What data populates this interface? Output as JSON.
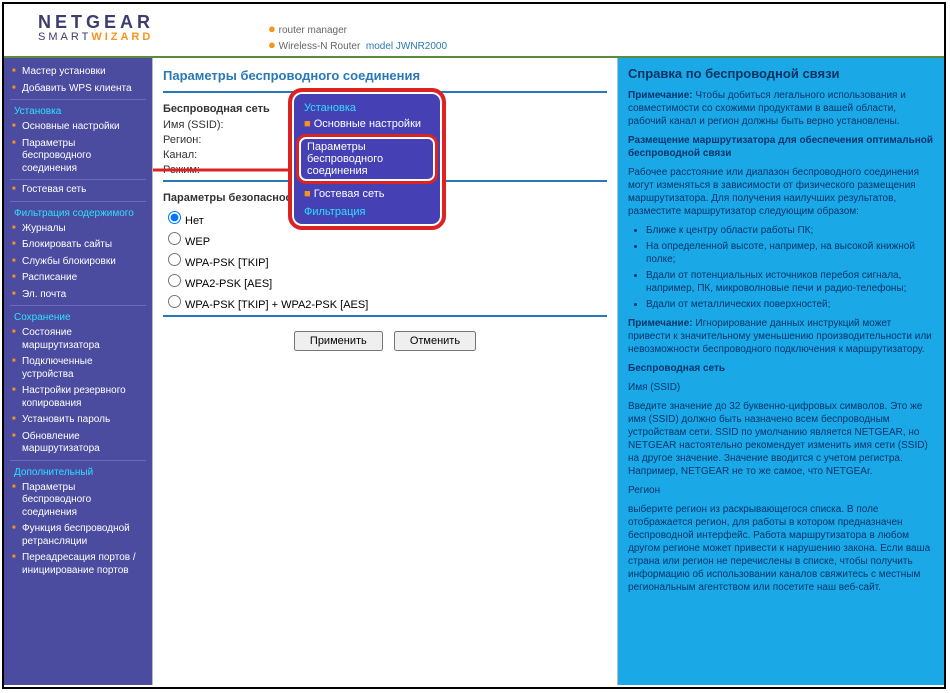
{
  "header": {
    "brand": "NETGEAR",
    "smart": "SMART",
    "wizard": "WIZARD",
    "router_manager": "router manager",
    "router_line": "Wireless-N Router",
    "model_label": "model",
    "model": "JWNR2000"
  },
  "sidebar": {
    "top": [
      "Мастер установки",
      "Добавить WPS клиента"
    ],
    "s1_head": "Установка",
    "s1": [
      "Основные настройки",
      "Параметры беспроводного соединения"
    ],
    "s2_items": [
      "Гостевая сеть"
    ],
    "s3_head": "Фильтрация содержимого",
    "s3": [
      "Журналы",
      "Блокировать сайты",
      "Службы блокировки",
      "Расписание",
      "Эл. почта"
    ],
    "s4_head": "Сохранение",
    "s4": [
      "Состояние маршрутизатора",
      "Подключенные устройства",
      "Настройки резервного копирования",
      "Установить пароль",
      "Обновление маршрутизатора"
    ],
    "s5_head": "Дополнительный",
    "s5": [
      "Параметры беспроводного соединения",
      "Функция беспроводной ретрансляции",
      "Переадресация портов / инициирование портов"
    ]
  },
  "main": {
    "title": "Параметры беспроводного соединения",
    "wireless_head": "Беспроводная сеть",
    "ssid_label": "Имя (SSID):",
    "region_label": "Регион:",
    "channel_label": "Канал:",
    "mode_label": "Режим:",
    "sec_head": "Параметры безопасности",
    "sec_opts": [
      "Нет",
      "WEP",
      "WPA-PSK [TKIP]",
      "WPA2-PSK [AES]",
      "WPA-PSK [TKIP] + WPA2-PSK [AES]"
    ],
    "apply": "Применить",
    "cancel": "Отменить"
  },
  "popup": {
    "sec1": "Установка",
    "item1": "Основные настройки",
    "highlight": "Параметры беспроводного соединения",
    "item2": "Гостевая сеть",
    "sec2": "Фильтрация"
  },
  "help": {
    "title": "Справка по беспроводной связи",
    "p1_label": "Примечание:",
    "p1": "Чтобы добиться легального использования и совместимости со схожими продуктами в вашей области, рабочий канал и регион должны быть верно установлены.",
    "p2_head": "Размещение маршрутизатора для обеспечения оптимальной беспроводной связи",
    "p3": "Рабочее расстояние или диапазон беспроводного соединения могут изменяться в зависимости от физического размещения маршрутизатора. Для получения наилучших результатов, разместите маршрутизатор следующим образом:",
    "bullets": [
      "Ближе к центру области работы ПК;",
      "На определенной высоте, например, на высокой книжной полке;",
      "Вдали от потенциальных источников перебоя сигнала, например, ПК, микроволновые печи и радио-телефоны;",
      "Вдали от металлических поверхностей;"
    ],
    "p4_label": "Примечание:",
    "p4": "Игнорирование данных инструкций может привести к значительному уменьшению производительности или невозможности беспроводного подключения к маршрутизатору.",
    "p5_head": "Беспроводная сеть",
    "p6_head": "Имя (SSID)",
    "p6": "Введите значение до 32 буквенно-цифровых символов. Это же имя (SSID) должно быть назначено всем беспроводным устройствам сети. SSID по умолчанию является NETGEAR, но NETGEAR настоятельно рекомендует изменить имя сети (SSID) на другое значение. Значение вводится с учетом регистра. Например, NETGEAR не то же самое, что NETGEAr.",
    "p7_head": "Регион",
    "p7": "выберите регион из раскрывающегося списка. В поле отображается регион, для работы в котором предназначен беспроводной интерфейс. Работа маршрутизатора в любом другом регионе может привести к нарушению закона. Если ваша страна или регион не перечислены в списке, чтобы получить информацию об использовании каналов свяжитесь с местным региональным агентством или посетите наш веб-сайт."
  }
}
